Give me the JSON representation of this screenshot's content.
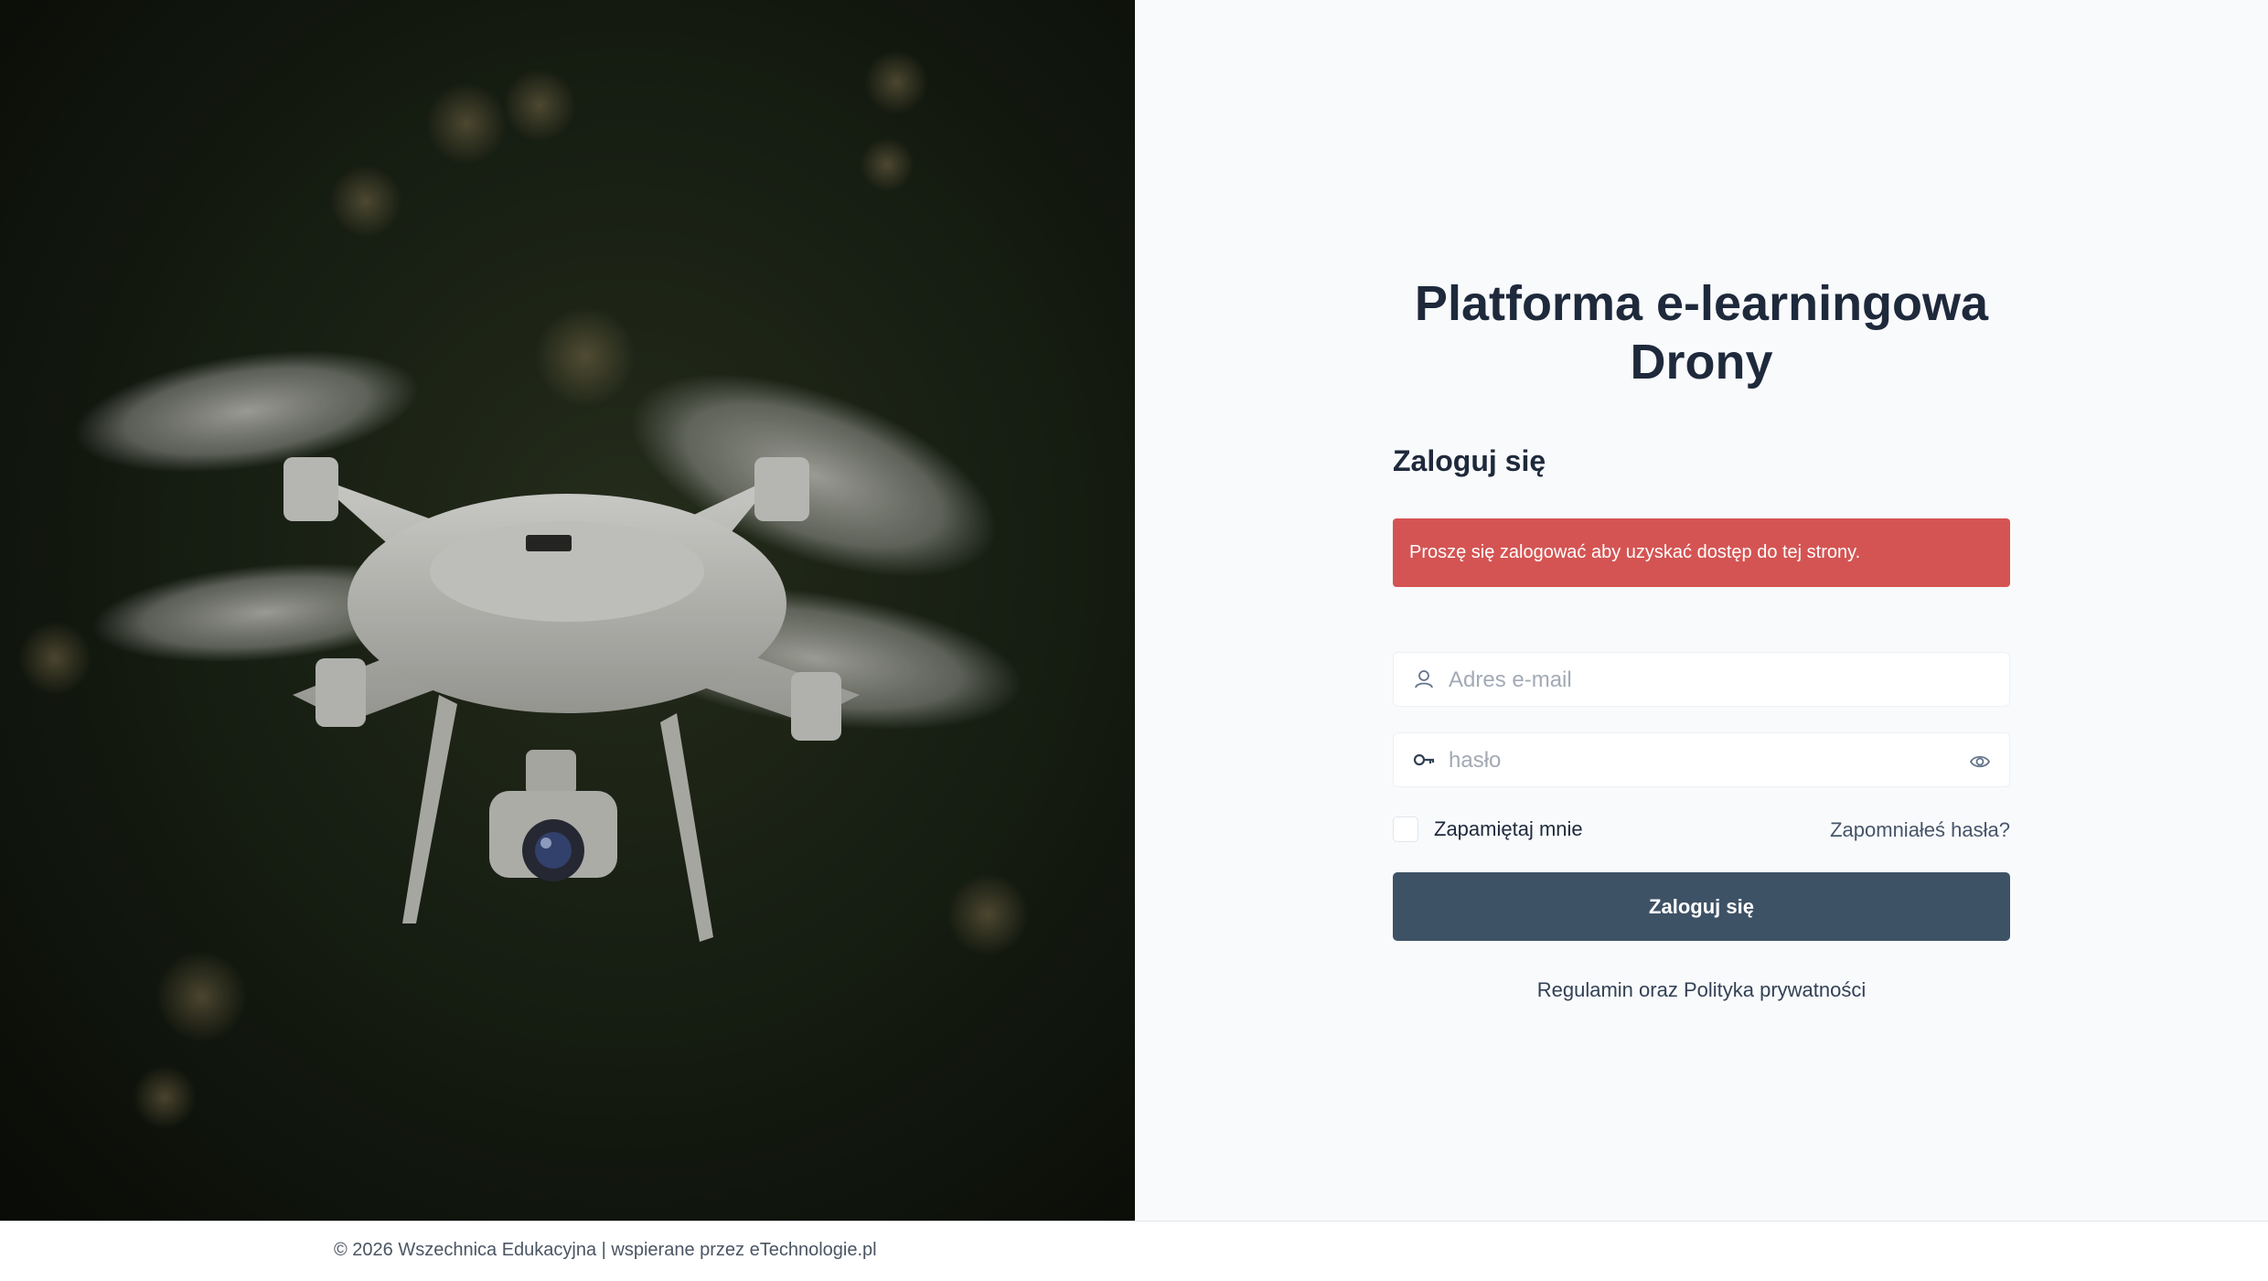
{
  "hero": {
    "image_subject": "drone-photo"
  },
  "login": {
    "title_line1": "Platforma e-learningowa",
    "title_line2": "Drony",
    "heading": "Zaloguj się",
    "alert_message": "Proszę się zalogować aby uzyskać dostęp do tej strony.",
    "email_placeholder": "Adres e-mail",
    "email_value": "",
    "password_placeholder": "hasło",
    "password_value": "",
    "remember_label": "Zapamiętaj mnie",
    "remember_checked": false,
    "forgot_link": "Zapomniałeś hasła?",
    "submit_label": "Zaloguj się",
    "terms_link": "Regulamin oraz Polityka prywatności"
  },
  "footer": {
    "text": "© 2026 Wszechnica Edukacyjna | wspierane przez eTechnologie.pl"
  },
  "icons": {
    "email": "user-icon",
    "password": "key-icon",
    "toggle_password": "eye-icon"
  },
  "colors": {
    "alert_bg": "#d45453",
    "submit_bg": "#3e5266",
    "panel_bg": "#f8fafc",
    "title_text": "#1e293b"
  }
}
